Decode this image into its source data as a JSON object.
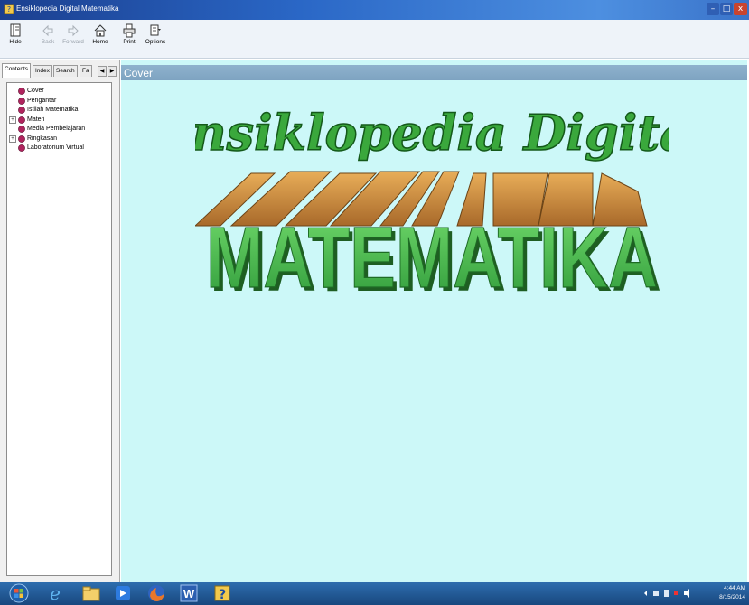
{
  "window": {
    "title": "Ensiklopedia Digital Matematika",
    "controls": {
      "minimize": "–",
      "maximize": "□",
      "close": "x"
    }
  },
  "toolbar": {
    "hide": "Hide",
    "back": "Back",
    "forward": "Forward",
    "home": "Home",
    "print": "Print",
    "options": "Options"
  },
  "nav": {
    "tabs": [
      "Contents",
      "Index",
      "Search",
      "Fa"
    ],
    "tree": [
      {
        "label": "Cover",
        "expandable": false
      },
      {
        "label": "Pengantar",
        "expandable": false
      },
      {
        "label": "Istilah Matematika",
        "expandable": false
      },
      {
        "label": "Materi",
        "expandable": true
      },
      {
        "label": "Media Pembelajaran",
        "expandable": false
      },
      {
        "label": "Ringkasan",
        "expandable": true
      },
      {
        "label": "Laboratorium Virtual",
        "expandable": false
      }
    ]
  },
  "content": {
    "topic_title": "Cover",
    "logo_script": "Ensiklopedia Digital",
    "logo_block": "MATEMATIKA"
  },
  "taskbar": {
    "clock_time": "4:44 AM",
    "clock_date": "8/15/2014"
  },
  "colors": {
    "titlebar": "#2a67c6",
    "content_bg": "#ccf8f8",
    "topic_header": "#8fb2cd",
    "logo_green": "#48b84a",
    "logo_wood": "#c98a3c"
  }
}
